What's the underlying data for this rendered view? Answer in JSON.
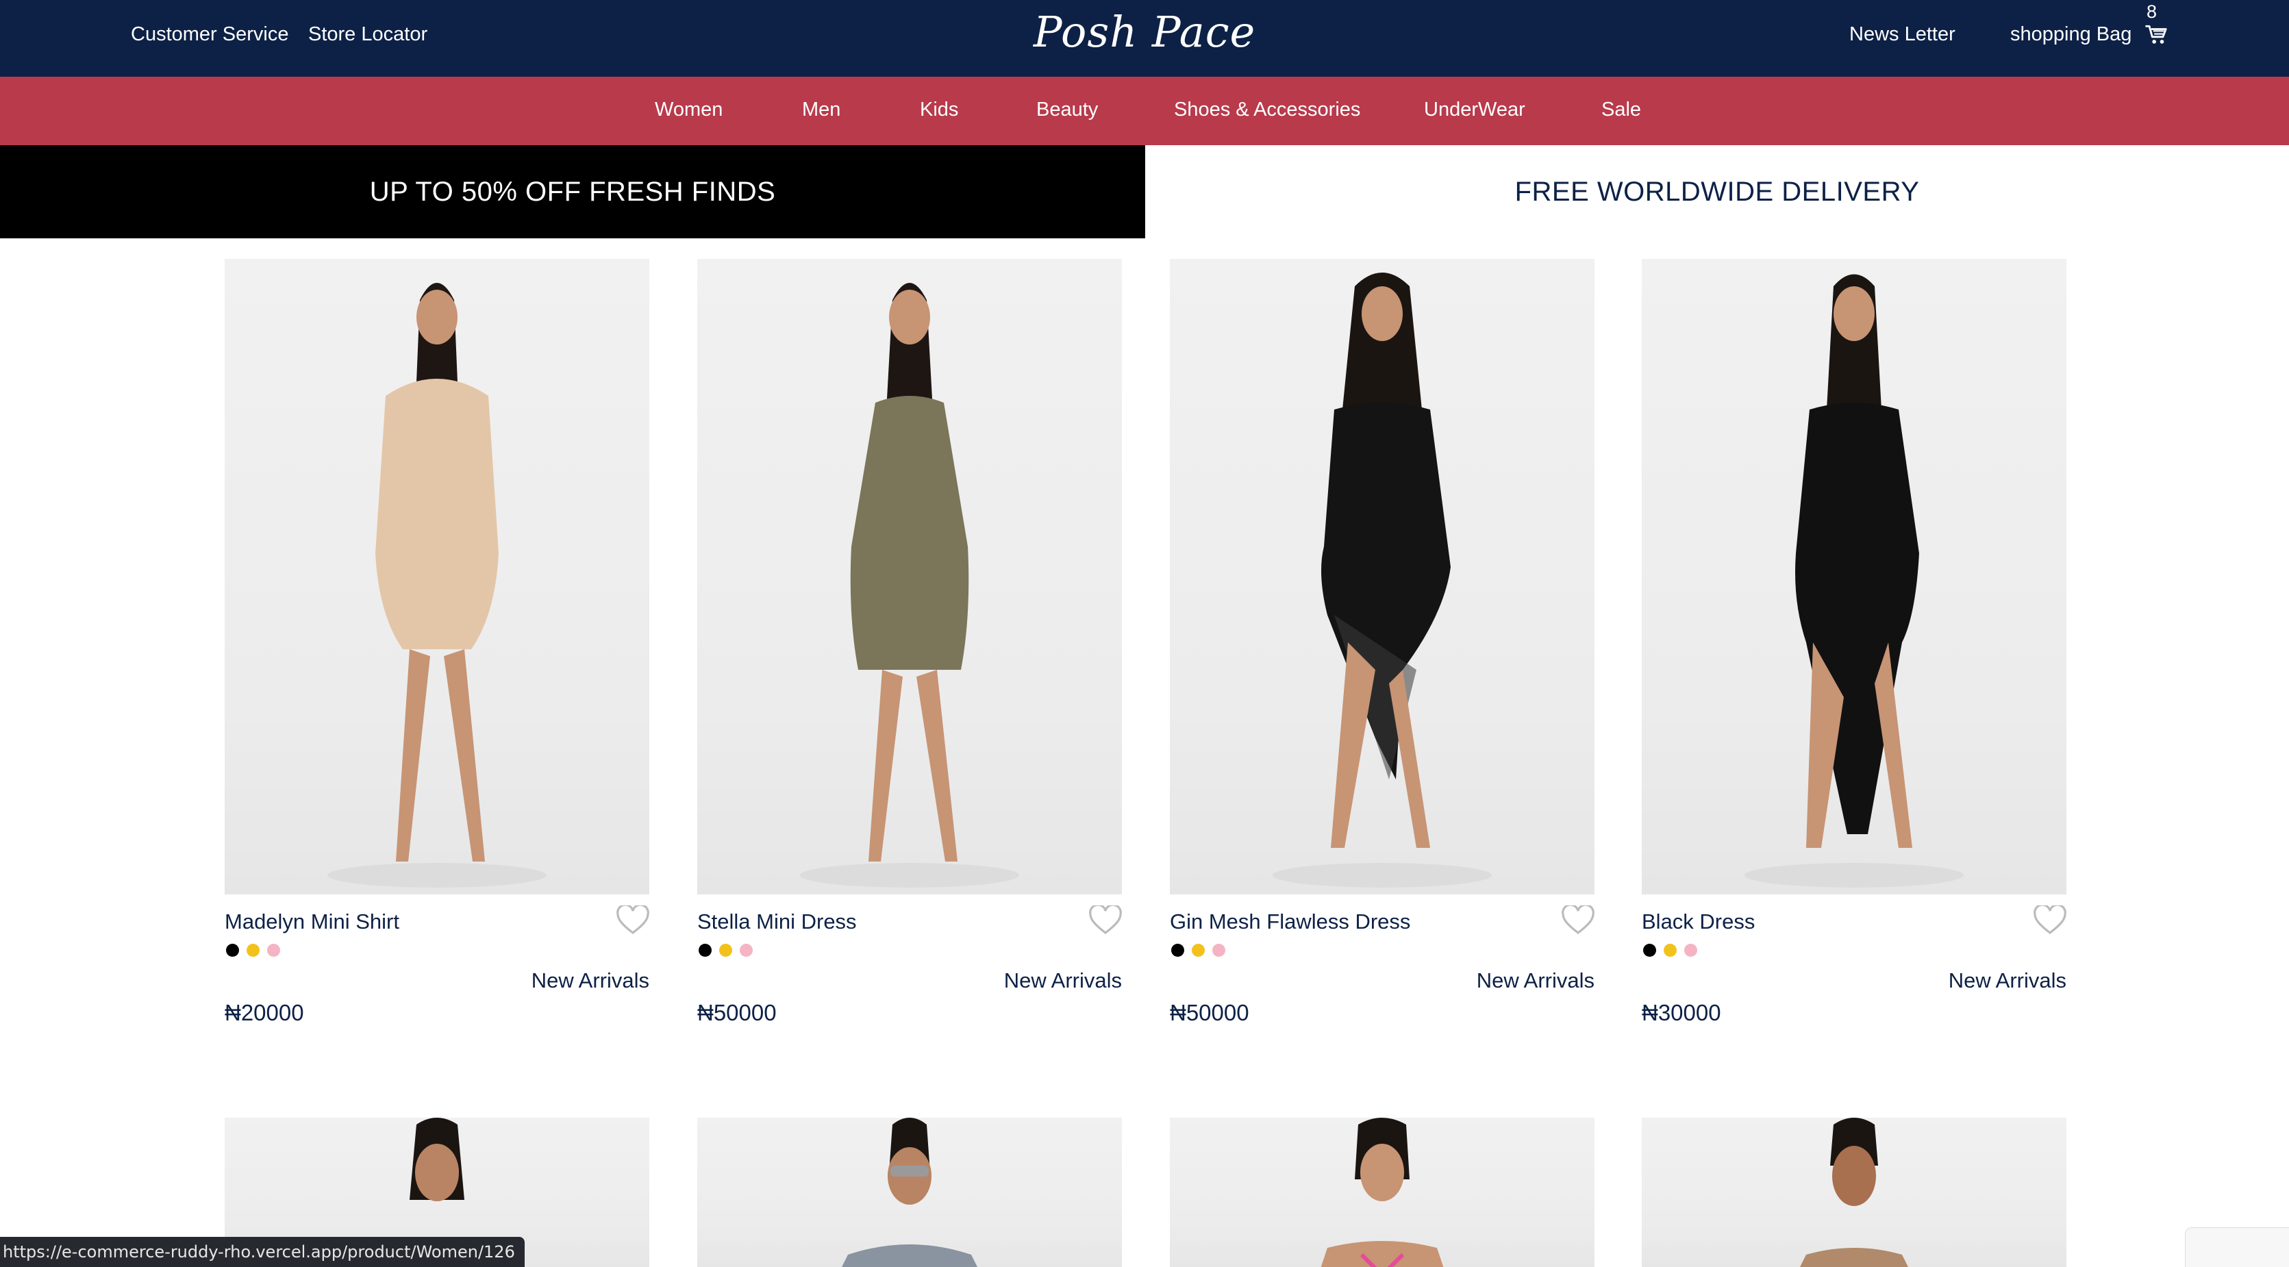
{
  "header": {
    "left_links": [
      "Customer Service",
      "Store Locator"
    ],
    "logo": "Posh Pace",
    "right_links": [
      "News Letter",
      "shopping Bag"
    ],
    "cart_count": "8",
    "background": "#0d2146"
  },
  "nav": {
    "background": "#b83a4b",
    "items": [
      "Women",
      "Men",
      "Kids",
      "Beauty",
      "Shoes & Accessories",
      "UnderWear",
      "Sale"
    ]
  },
  "promo": {
    "left": "UP TO 50% OFF FRESH FINDS",
    "right": "FREE WORLDWIDE DELIVERY"
  },
  "products": [
    {
      "name": "Madelyn Mini Shirt",
      "tag": "New Arrivals",
      "price": "₦20000",
      "dress_color": "#e3c6a8",
      "colors": [
        "#000000",
        "#f2c21b",
        "#f4b4c4"
      ]
    },
    {
      "name": "Stella Mini Dress",
      "tag": "New Arrivals",
      "price": "₦50000",
      "dress_color": "#7b7559",
      "colors": [
        "#000000",
        "#f2c21b",
        "#f4b4c4"
      ]
    },
    {
      "name": "Gin Mesh Flawless Dress",
      "tag": "New Arrivals",
      "price": "₦50000",
      "dress_color": "#141414",
      "colors": [
        "#000000",
        "#f2c21b",
        "#f4b4c4"
      ]
    },
    {
      "name": "Black Dress",
      "tag": "New Arrivals",
      "price": "₦30000",
      "dress_color": "#111111",
      "colors": [
        "#000000",
        "#f2c21b",
        "#f4b4c4"
      ]
    }
  ],
  "status_url": "https://e-commerce-ruddy-rho.vercel.app/product/Women/126"
}
